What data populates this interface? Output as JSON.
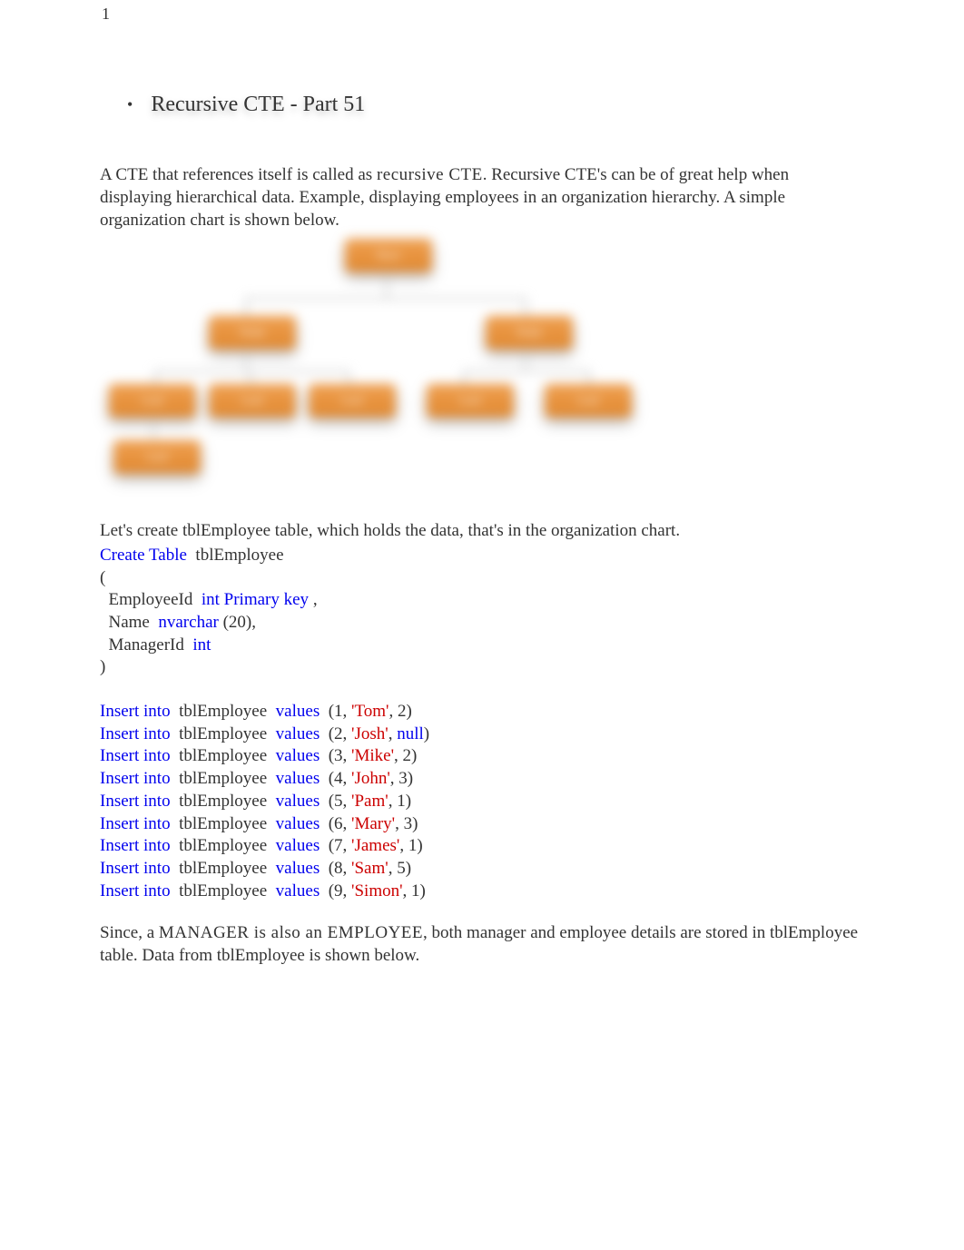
{
  "page_number": "1",
  "title": "Recursive CTE - Part 51",
  "para1_a": "A CTE that references itself is called as ",
  "para1_b": "recursive CTE",
  "para1_c": ". Recursive CTE's can be of great help when displaying hierarchical data. Example, displaying employees in an organization hierarchy. A simple organization chart is shown below.",
  "org_chart_nodes": [
    "Root",
    "Node",
    "Node",
    "Leaf",
    "Leaf",
    "Leaf",
    "Leaf",
    "Leaf",
    "Leaf"
  ],
  "para2": "Let's create tblEmployee table, which holds the data, that's in the organization chart.",
  "sql": {
    "create_table_kw": "Create Table",
    "tbl_name": "tblEmployee",
    "open_paren": "(",
    "col1_name": "EmployeeId",
    "col1_type": "int Primary key",
    "col1_tail": ",",
    "col2_name": "Name",
    "col2_type": "nvarchar",
    "col2_tail": "(20),",
    "col3_name": "ManagerId",
    "col3_type": "int",
    "close_paren": ")",
    "insert_kw": "Insert into",
    "values_kw": "values",
    "null_kw": "null",
    "rows": [
      {
        "id": "1",
        "name": "'Tom'",
        "mgr": "2",
        "mgr_is_null": false
      },
      {
        "id": "2",
        "name": "'Josh'",
        "mgr": "null",
        "mgr_is_null": true
      },
      {
        "id": "3",
        "name": "'Mike'",
        "mgr": "2",
        "mgr_is_null": false
      },
      {
        "id": "4",
        "name": "'John'",
        "mgr": "3",
        "mgr_is_null": false
      },
      {
        "id": "5",
        "name": "'Pam'",
        "mgr": "1",
        "mgr_is_null": false
      },
      {
        "id": "6",
        "name": "'Mary'",
        "mgr": "3",
        "mgr_is_null": false
      },
      {
        "id": "7",
        "name": "'James'",
        "mgr": "1",
        "mgr_is_null": false
      },
      {
        "id": "8",
        "name": "'Sam'",
        "mgr": "5",
        "mgr_is_null": false
      },
      {
        "id": "9",
        "name": "'Simon'",
        "mgr": "1",
        "mgr_is_null": false
      }
    ]
  },
  "para3_a": "Since, a ",
  "para3_b": "MANAGER is also an EMPLOYEE",
  "para3_c": ", both manager and employee details are stored in tblEmployee table. Data from tblEmployee is shown below."
}
